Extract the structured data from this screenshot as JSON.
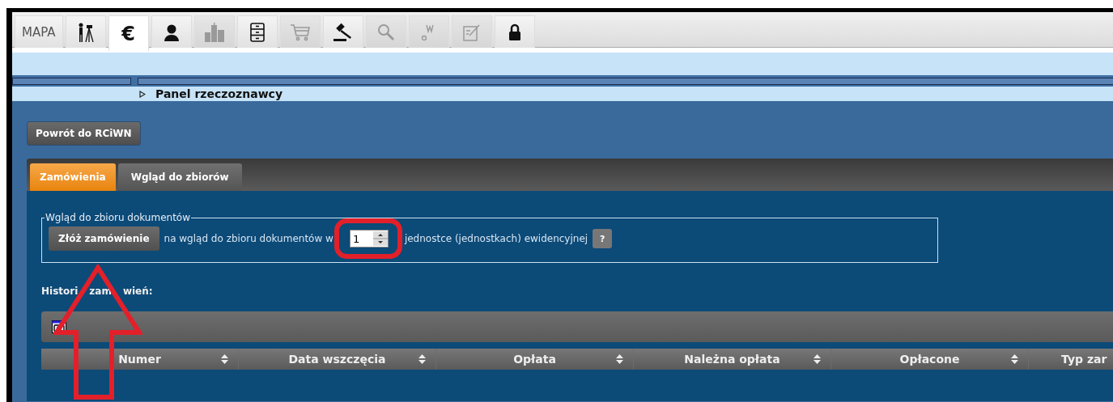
{
  "toolbar": {
    "tabs": [
      {
        "kind": "text",
        "label": "MAPA",
        "selected": false,
        "disabled": false
      },
      {
        "kind": "surveyor",
        "selected": false,
        "disabled": false
      },
      {
        "kind": "text",
        "label": "€",
        "selected": true,
        "disabled": false
      },
      {
        "kind": "person",
        "selected": false,
        "disabled": false
      },
      {
        "kind": "buildings",
        "selected": false,
        "disabled": true
      },
      {
        "kind": "cabinet",
        "selected": false,
        "disabled": false
      },
      {
        "kind": "cart",
        "selected": false,
        "disabled": true
      },
      {
        "kind": "gavel",
        "selected": false,
        "disabled": false
      },
      {
        "kind": "search",
        "selected": false,
        "disabled": true
      },
      {
        "kind": "w",
        "selected": false,
        "disabled": true
      },
      {
        "kind": "form",
        "selected": false,
        "disabled": true
      },
      {
        "kind": "lock",
        "selected": false,
        "disabled": false
      }
    ]
  },
  "breadcrumb": {
    "label": "Panel rzeczoznawcy"
  },
  "back_button": "Powrót do RCiWN",
  "tabs": [
    {
      "label": "Zamówienia",
      "selected": true
    },
    {
      "label": "Wgląd do zbiorów",
      "selected": false
    }
  ],
  "order_group": {
    "legend": "Wgląd do zbioru dokumentów",
    "button": "Złóż zamówienie",
    "text_before": "na wgląd do zbioru dokumentów w",
    "quantity": {
      "value": "1"
    },
    "text_after": "jednostce (jednostkach) ewidencyjnej",
    "help": "?"
  },
  "history": {
    "title_parts": [
      "Histori",
      "zam",
      "wień:"
    ],
    "columns": [
      {
        "label": "Numer",
        "sortable": true
      },
      {
        "label": "Data wszczęcia",
        "sortable": true
      },
      {
        "label": "Opłata",
        "sortable": true
      },
      {
        "label": "Należna opłata",
        "sortable": true
      },
      {
        "label": "Opłacone",
        "sortable": true
      },
      {
        "label": "Typ zar",
        "sortable": false
      }
    ]
  },
  "markup": {
    "frame_around_quantity": true,
    "arrow_to_order_button": true
  }
}
